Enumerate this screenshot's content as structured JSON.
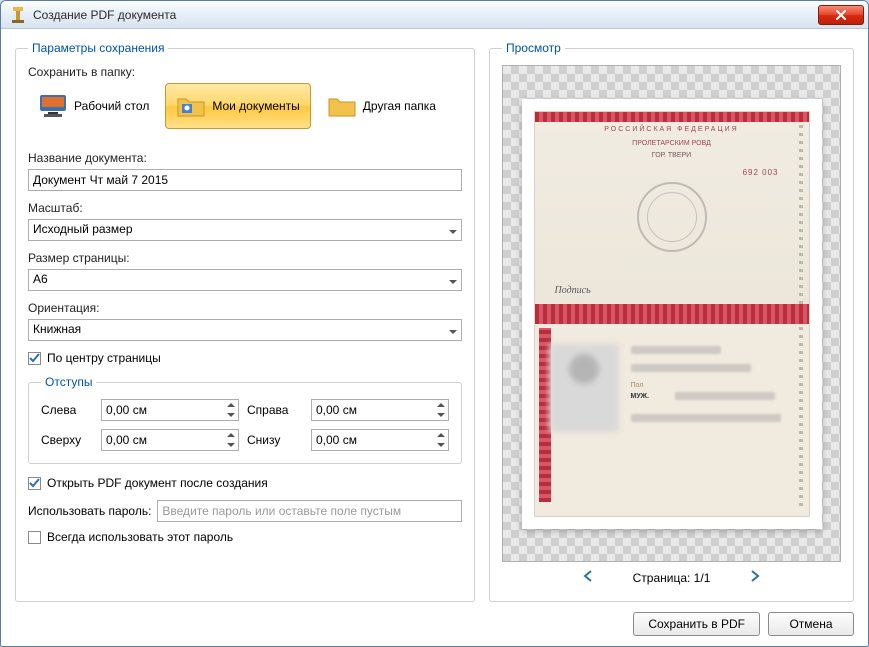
{
  "window": {
    "title": "Создание PDF документа"
  },
  "save_params": {
    "legend": "Параметры сохранения",
    "save_to_label": "Сохранить в папку:",
    "folders": {
      "desktop": "Рабочий стол",
      "my_docs": "Мои документы",
      "other": "Другая папка"
    },
    "doc_name_label": "Название документа:",
    "doc_name_value": "Документ Чт май 7 2015",
    "scale_label": "Масштаб:",
    "scale_value": "Исходный размер",
    "page_size_label": "Размер страницы:",
    "page_size_value": "A6",
    "orientation_label": "Ориентация:",
    "orientation_value": "Книжная",
    "center_label": "По центру страницы",
    "margins": {
      "legend": "Отступы",
      "left_label": "Слева",
      "right_label": "Справа",
      "top_label": "Сверху",
      "bottom_label": "Снизу",
      "value": "0,00 см"
    },
    "open_after_label": "Открыть PDF документ после создания",
    "password_label": "Использовать пароль:",
    "password_placeholder": "Введите пароль или оставьте поле пустым",
    "always_password_label": "Всегда использовать этот пароль"
  },
  "preview": {
    "legend": "Просмотр",
    "passport": {
      "country": "РОССИЙСКАЯ ФЕДЕРАЦИЯ",
      "line1": "ПРОЛЕТАРСКИМ РОВД",
      "line2": "ГОР. ТВЕРИ",
      "number": "692 003",
      "gender_label": "Пол",
      "gender_value": "МУЖ."
    },
    "pager_text": "Страница: 1/1"
  },
  "buttons": {
    "save": "Сохранить в PDF",
    "cancel": "Отмена"
  }
}
